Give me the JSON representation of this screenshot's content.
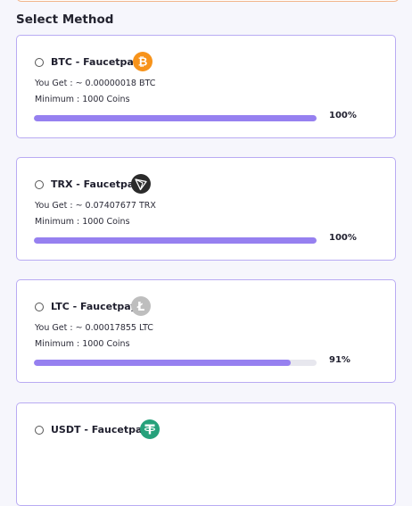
{
  "page": {
    "section_title": "Select Method"
  },
  "methods": [
    {
      "name": "BTC - Faucetpay",
      "you_get": "You Get : ~ 0.00000018 BTC",
      "minimum": "Minimum : 1000 Coins",
      "progress_percent": 100,
      "progress_label": "100%",
      "icon": "bitcoin-icon",
      "icon_color": "#f7931a"
    },
    {
      "name": "TRX - Faucetpay",
      "you_get": "You Get : ~ 0.07407677 TRX",
      "minimum": "Minimum : 1000 Coins",
      "progress_percent": 100,
      "progress_label": "100%",
      "icon": "tron-icon",
      "icon_color": "#2b2b2b"
    },
    {
      "name": "LTC - Faucetpay",
      "you_get": "You Get : ~ 0.00017855 LTC",
      "minimum": "Minimum : 1000 Coins",
      "progress_percent": 91,
      "progress_label": "91%",
      "icon": "litecoin-icon",
      "icon_color": "#bebebe"
    },
    {
      "name": "USDT - Faucetpay",
      "icon": "tether-icon",
      "icon_color": "#26a17b"
    }
  ],
  "colors": {
    "accent": "#9680f0",
    "card_border": "#b9abf3",
    "track": "#e7e7ee"
  }
}
